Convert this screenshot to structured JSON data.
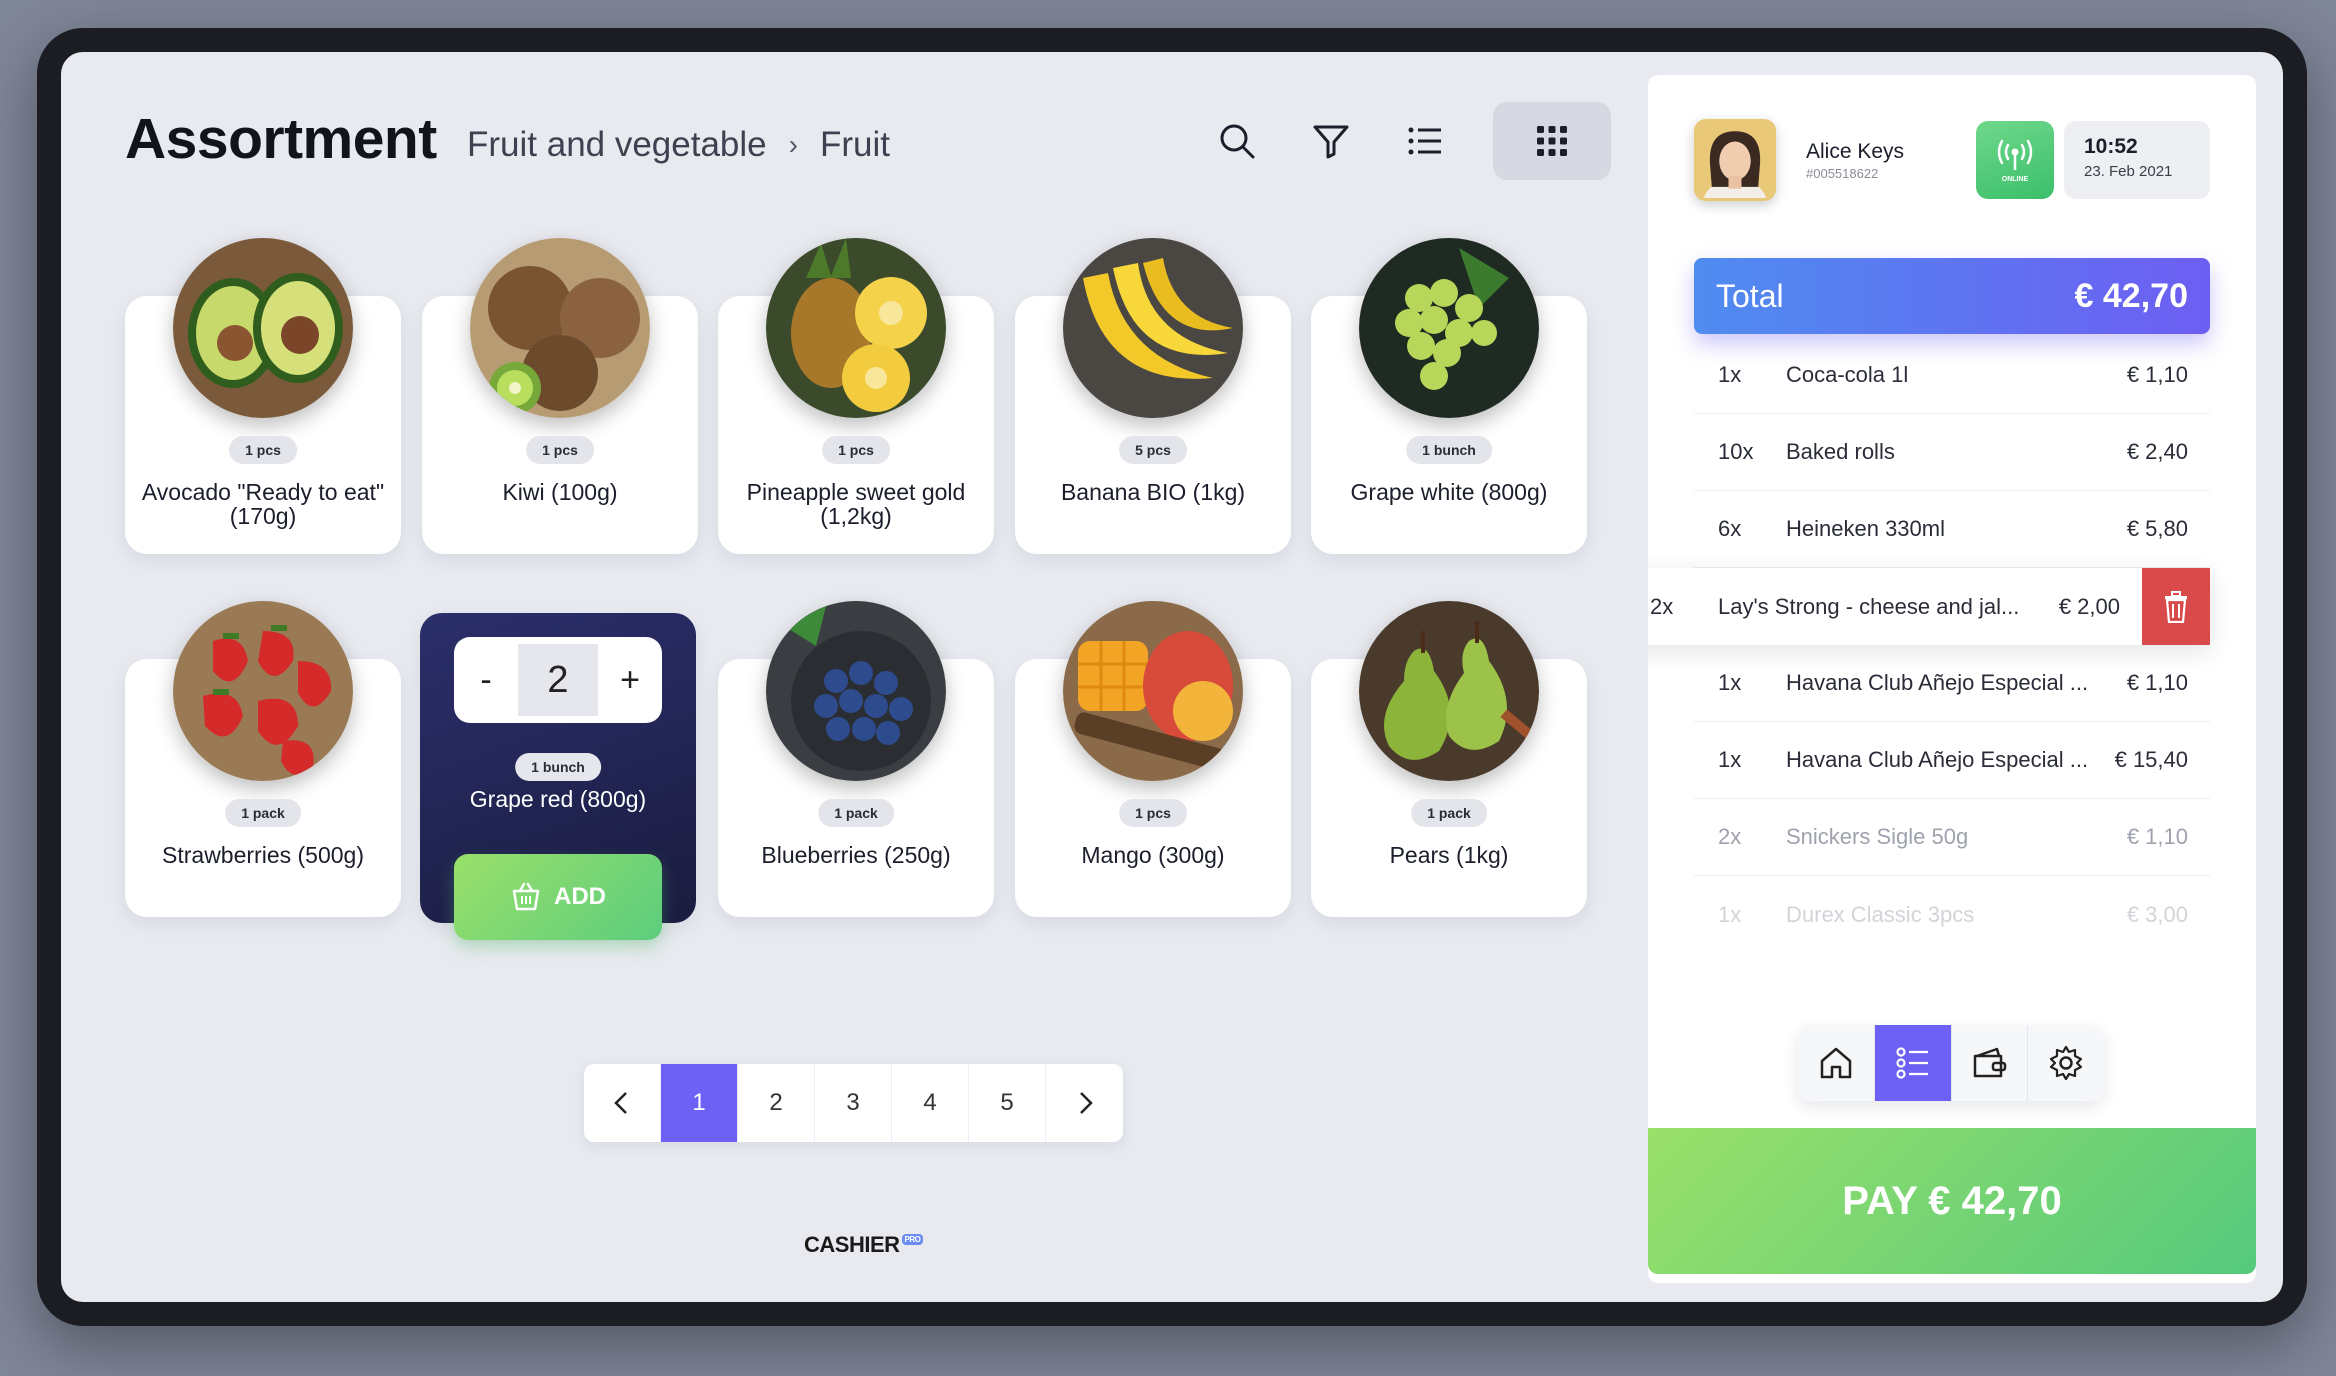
{
  "header": {
    "title": "Assortment",
    "breadcrumb": [
      "Fruit and vegetable",
      "Fruit"
    ],
    "breadcrumb_separator": "›"
  },
  "toolbar": {
    "icons": [
      "search-icon",
      "filter-icon",
      "list-view-icon",
      "grid-view-icon"
    ],
    "active_view": "grid"
  },
  "products": [
    {
      "name": "Avocado \"Ready to eat\" (170g)",
      "unit": "1 pcs"
    },
    {
      "name": "Kiwi (100g)",
      "unit": "1 pcs"
    },
    {
      "name": "Pineapple sweet gold (1,2kg)",
      "unit": "1 pcs"
    },
    {
      "name": "Banana BIO (1kg)",
      "unit": "5 pcs"
    },
    {
      "name": "Grape white (800g)",
      "unit": "1 bunch"
    },
    {
      "name": "Strawberries (500g)",
      "unit": "1 pack"
    },
    {
      "name": "Grape red (800g)",
      "unit": "1 bunch",
      "selected": true,
      "quantity": "2",
      "minus": "-",
      "plus": "+",
      "add_label": "ADD"
    },
    {
      "name": "Blueberries (250g)",
      "unit": "1 pack"
    },
    {
      "name": "Mango (300g)",
      "unit": "1 pcs"
    },
    {
      "name": "Pears (1kg)",
      "unit": "1 pack"
    }
  ],
  "pagination": {
    "pages": [
      "1",
      "2",
      "3",
      "4",
      "5"
    ],
    "current": "1"
  },
  "brand": {
    "name": "CASHIER",
    "tag": "PRO"
  },
  "user": {
    "name": "Alice Keys",
    "id": "#005518622",
    "status": "ONLINE"
  },
  "clock": {
    "time": "10:52",
    "date": "23. Feb 2021"
  },
  "cart": {
    "total_label": "Total",
    "total_amount": "€ 42,70",
    "lines": [
      {
        "qty": "1x",
        "name": "Coca-cola 1l",
        "price": "€ 1,10"
      },
      {
        "qty": "10x",
        "name": "Baked rolls",
        "price": "€ 2,40"
      },
      {
        "qty": "6x",
        "name": "Heineken 330ml",
        "price": "€ 5,80"
      },
      {
        "qty": "2x",
        "name": "Lay's Strong - cheese and jal...",
        "price": "€ 2,00",
        "active": true
      },
      {
        "qty": "1x",
        "name": "Havana Club Añejo Especial ...",
        "price": "€ 1,10"
      },
      {
        "qty": "1x",
        "name": "Havana Club Añejo Especial ...",
        "price": "€ 15,40"
      },
      {
        "qty": "2x",
        "name": "Snickers Sigle 50g",
        "price": "€ 1,10"
      },
      {
        "qty": "1x",
        "name": "Durex Classic 3pcs",
        "price": "€ 3,00"
      }
    ]
  },
  "bottom_nav": {
    "icons": [
      "home-icon",
      "checklist-icon",
      "wallet-icon",
      "settings-icon"
    ],
    "active": "checklist-icon"
  },
  "pay_button": {
    "label": "PAY € 42,70"
  },
  "colors": {
    "accent": "#6c61f4",
    "total_gradient_start": "#4f8cf0",
    "pay_gradient_start": "#9ae06a",
    "pay_gradient_end": "#55c97d",
    "delete": "#d94b4b",
    "selected_card": "#1f2150"
  }
}
